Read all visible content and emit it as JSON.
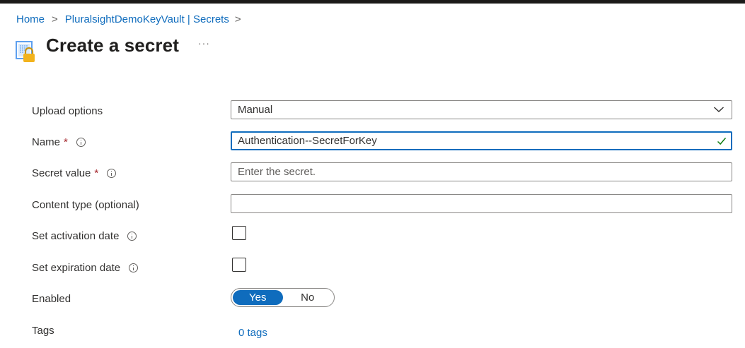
{
  "breadcrumb": {
    "items": [
      "Home",
      "PluralsightDemoKeyVault | Secrets"
    ],
    "separator": ">"
  },
  "header": {
    "title": "Create a secret",
    "more": "···"
  },
  "form": {
    "upload_options": {
      "label": "Upload options",
      "value": "Manual"
    },
    "name": {
      "label": "Name",
      "required_marker": "*",
      "value": "Authentication--SecretForKey",
      "valid": true
    },
    "secret_value": {
      "label": "Secret value",
      "required_marker": "*",
      "placeholder": "Enter the secret.",
      "value": ""
    },
    "content_type": {
      "label": "Content type (optional)",
      "value": ""
    },
    "activation_date": {
      "label": "Set activation date",
      "checked": false
    },
    "expiration_date": {
      "label": "Set expiration date",
      "checked": false
    },
    "enabled": {
      "label": "Enabled",
      "options": [
        "Yes",
        "No"
      ],
      "selected": "Yes"
    },
    "tags": {
      "label": "Tags",
      "link": "0 tags"
    }
  },
  "colors": {
    "accent": "#0f6cbd",
    "required": "#a4262c",
    "valid": "#107c10",
    "icon_yellow": "#f2b31d"
  }
}
